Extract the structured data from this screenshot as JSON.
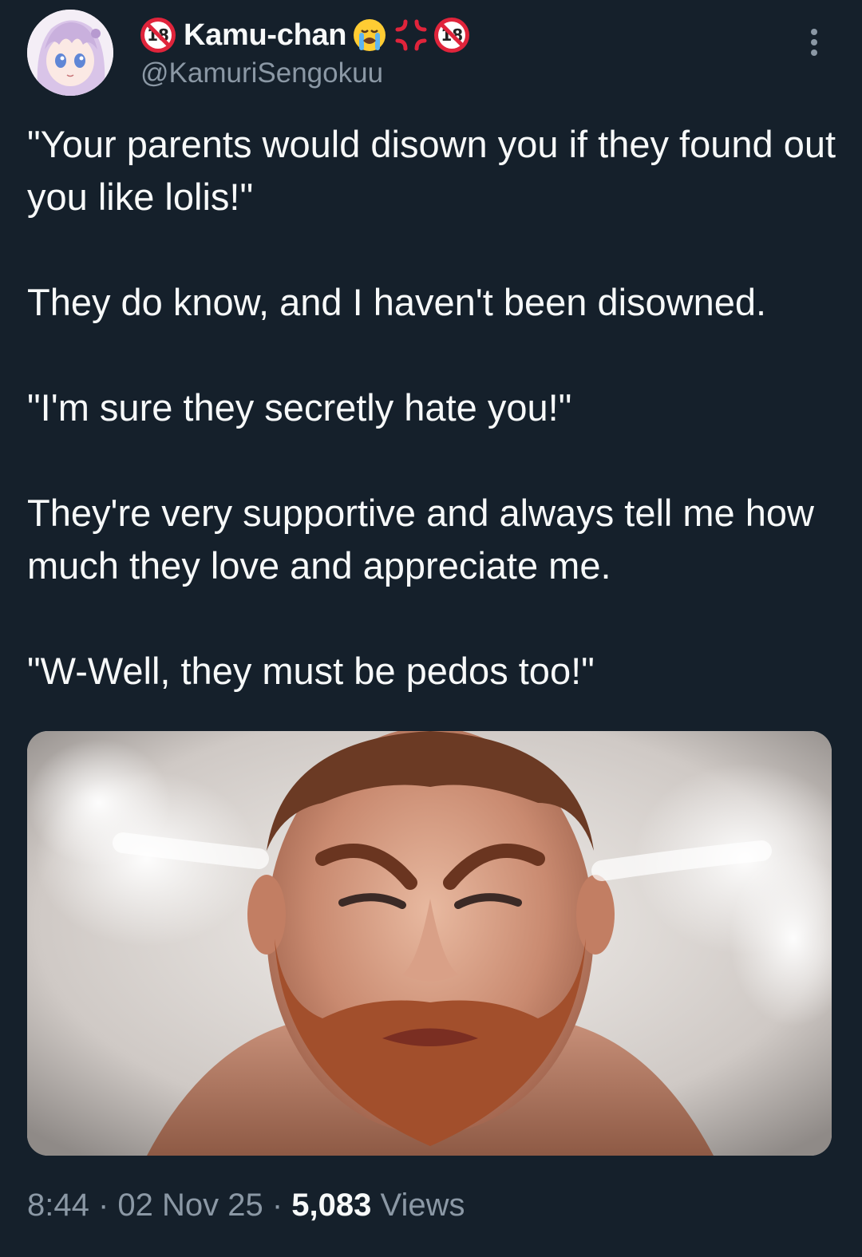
{
  "author": {
    "display_name": "Kamu-chan",
    "handle": "@KamuriSengokuu",
    "name_badges": [
      "no-under-18-icon",
      "crying-face-icon",
      "anger-symbol-icon",
      "no-under-18-icon"
    ],
    "badge_text": "18",
    "avatar_icon": "anime-girl-avatar"
  },
  "tweet": {
    "paragraphs": [
      "\"Your parents would disown you if they found out you like lolis!\"",
      "They do know, and I haven't been disowned.",
      "\"I'm sure they secretly hate you!\"",
      "They're very supportive and always tell me how much they love and appreciate me.",
      "\"W-Well, they must be pedos too!\""
    ],
    "media_description_icon": "angry-man-steam-photo",
    "time": "8:44",
    "separator": " · ",
    "date": "02 Nov 25",
    "views_count": "5,083",
    "views_label": "Views"
  },
  "colors": {
    "background": "#15202b",
    "primary_text": "#f7f9f9",
    "secondary_text": "#8b98a5",
    "badge_red": "#e0243b"
  }
}
